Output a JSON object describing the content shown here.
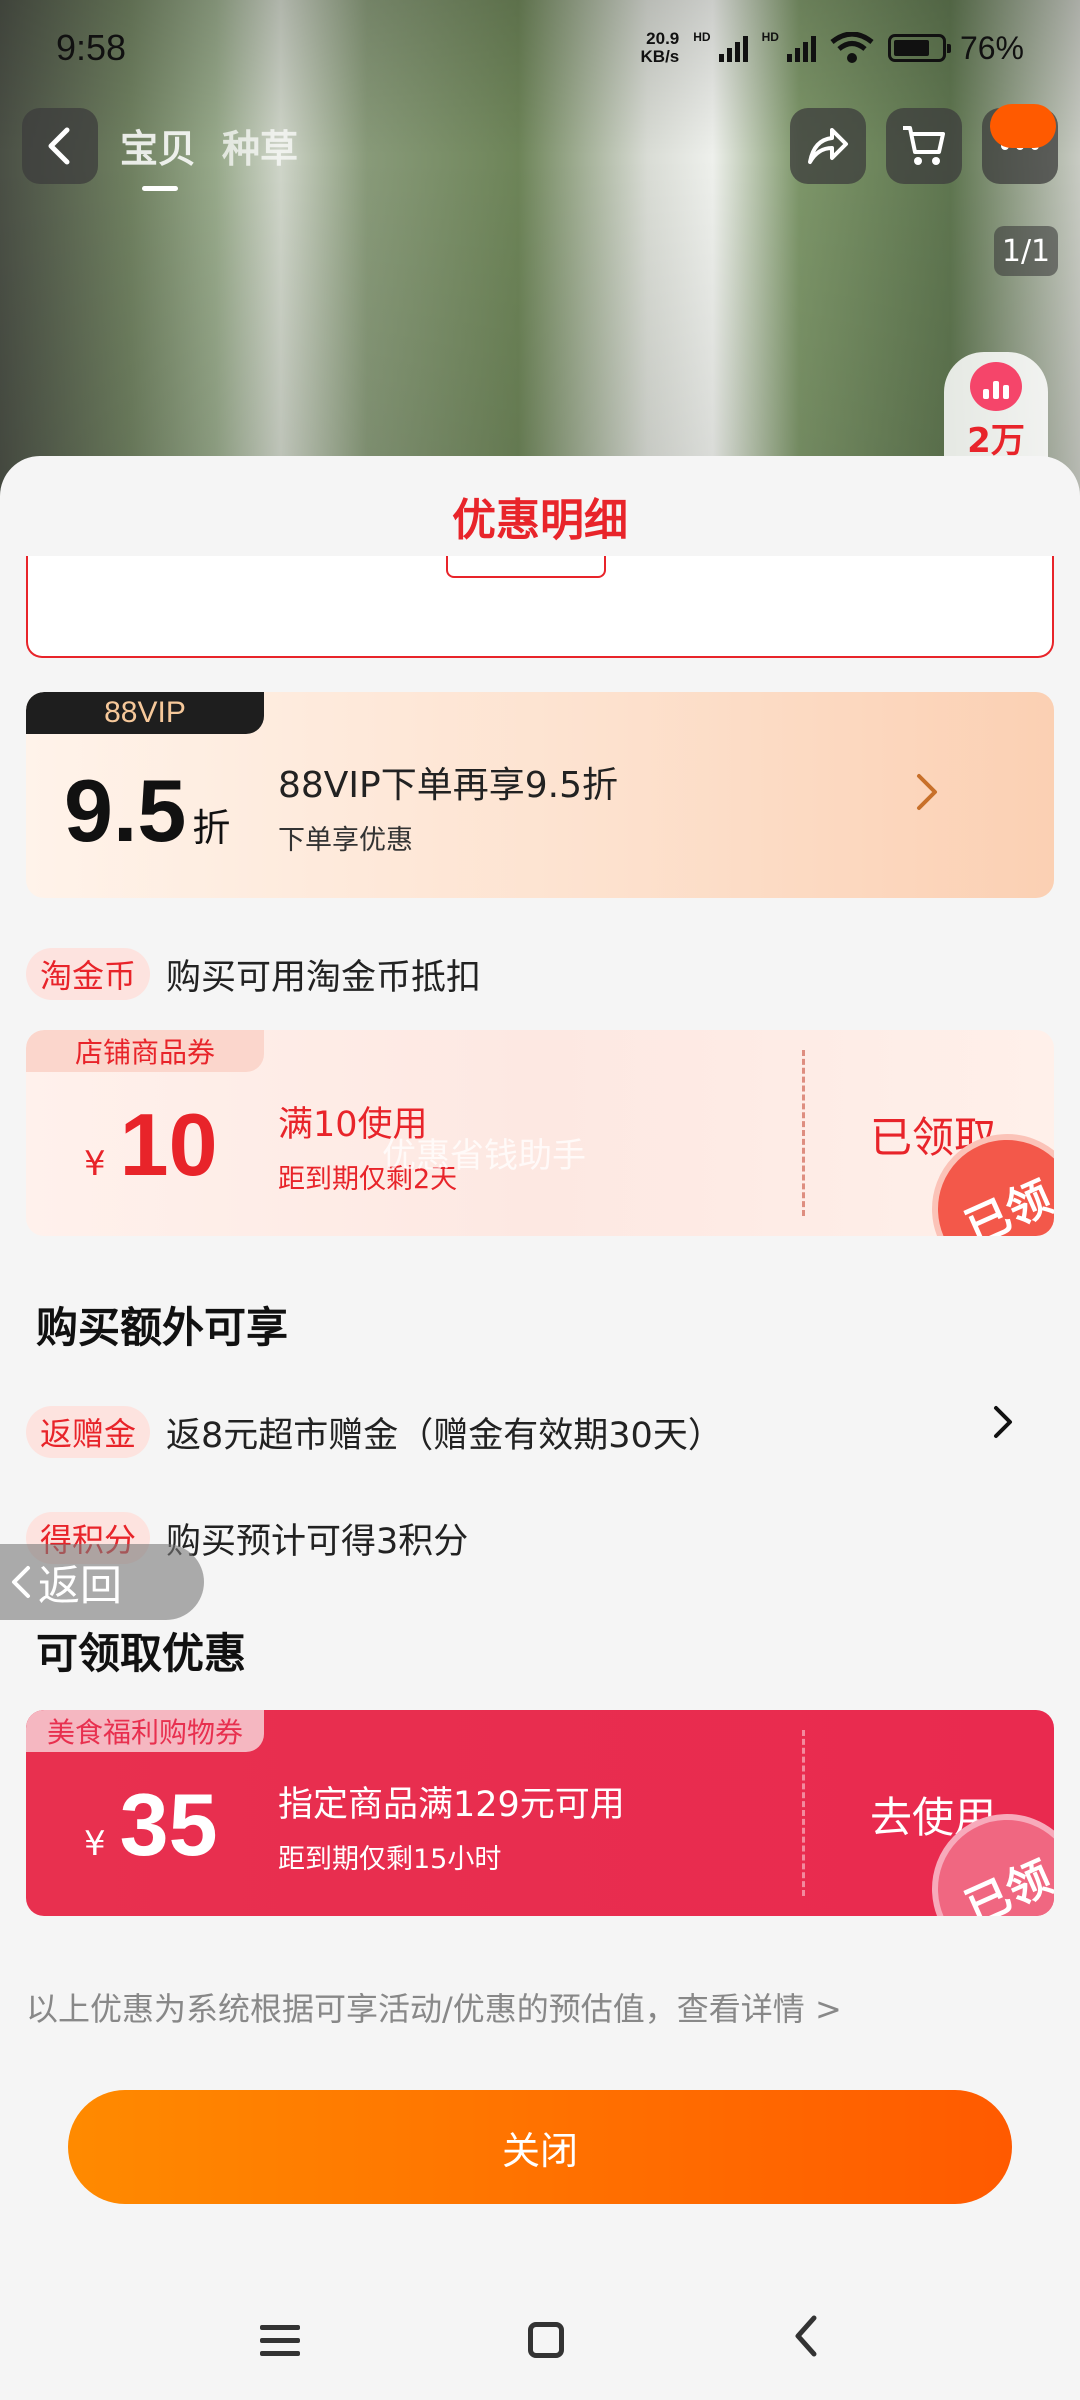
{
  "status_bar": {
    "time": "9:58",
    "net_speed_value": "20.9",
    "net_speed_unit": "KB/s",
    "hd_label": "HD",
    "battery": "76%"
  },
  "topbar": {
    "tabs": [
      "宝贝",
      "种草"
    ],
    "page_counter": "1/1",
    "side_stat": "2万"
  },
  "sheet": {
    "title": "优惠明细",
    "vip": {
      "tag": "88VIP",
      "discount": "9.5",
      "discount_unit": "折",
      "title": "88VIP下单再享9.5折",
      "subtitle": "下单享优惠"
    },
    "taojinbi": {
      "tag": "淘金币",
      "text": "购买可用淘金币抵扣"
    },
    "shop_coupon": {
      "tag": "店铺商品券",
      "currency": "¥",
      "amount": "10",
      "condition": "满10使用",
      "expiry": "距到期仅剩2天",
      "action": "已领取",
      "stamp": "已领",
      "watermark": "优惠省钱助手"
    },
    "extra_section_title": "购买额外可享",
    "rebate": {
      "tag": "返赠金",
      "text": "返8元超市赠金（赠金有效期30天）"
    },
    "points": {
      "tag": "得积分",
      "text": "购买预计可得3积分"
    },
    "claim_section_title": "可领取优惠",
    "food_coupon": {
      "tag": "美食福利购物券",
      "currency": "¥",
      "amount": "35",
      "condition": "指定商品满129元可用",
      "expiry": "距到期仅剩15小时",
      "action": "去使用",
      "stamp": "已领"
    },
    "footnote": "以上优惠为系统根据可享活动/优惠的预估值，查看详情 >",
    "close_button": "关闭"
  },
  "float_back": "返回",
  "colors": {
    "accent_red": "#e8242a",
    "close_orange": "#ff5a00",
    "coupon_red": "#e8304f"
  },
  "icons": [
    "back-arrow-icon",
    "share-icon",
    "cart-icon",
    "more-icon",
    "chart-icon",
    "chevron-right-icon",
    "menu-icon",
    "home-icon",
    "nav-back-icon"
  ]
}
